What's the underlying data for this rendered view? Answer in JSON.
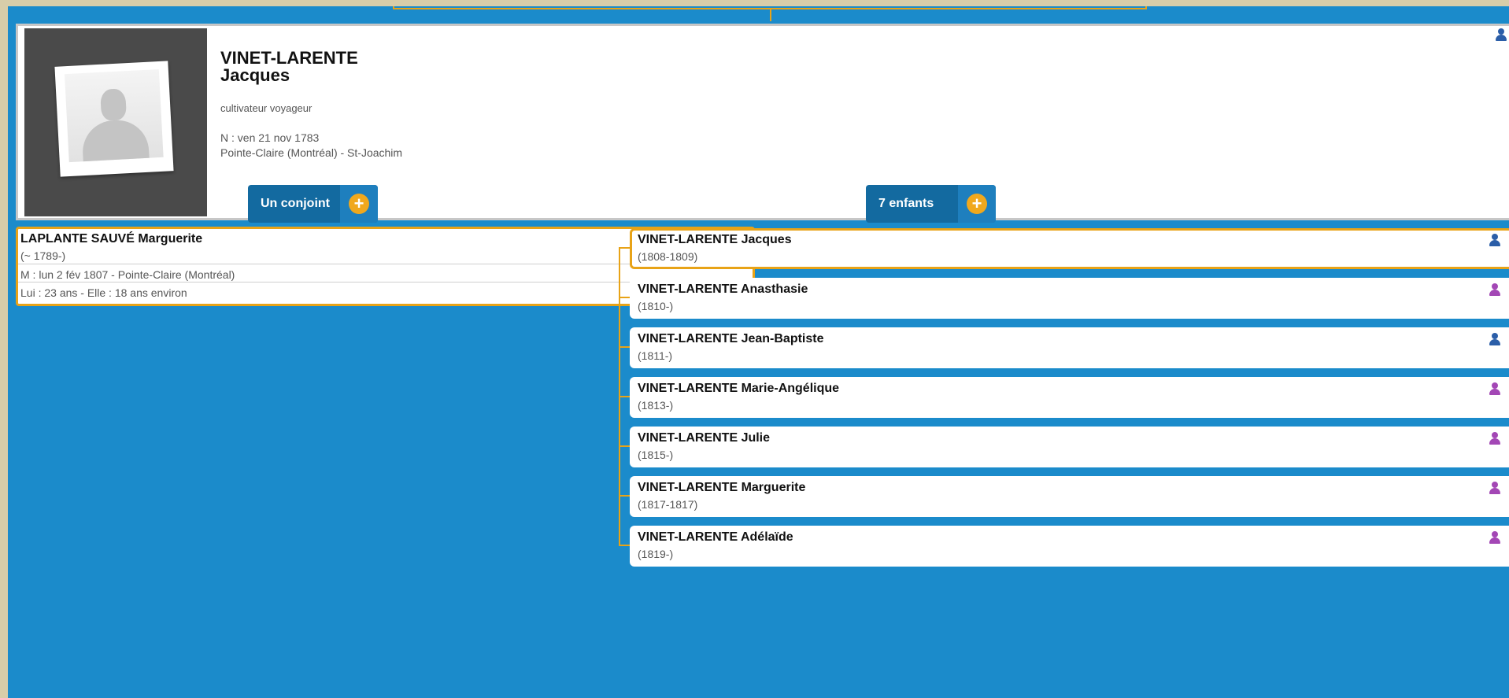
{
  "main_person": {
    "surname": "VINET-LARENTE",
    "given_name": "Jacques",
    "occupation": "cultivateur voyageur",
    "birth": "N : ven 21 nov 1783",
    "birth_place": "Pointe-Claire (Montréal) - St-Joachim",
    "gender": "male"
  },
  "spouse_section": {
    "label": "Un conjoint",
    "add_label": "+"
  },
  "children_section": {
    "label": "7 enfants",
    "add_label": "+"
  },
  "spouse": {
    "name": "LAPLANTE SAUVÉ Marguerite",
    "dates": "(~ 1789-)",
    "marriage": "M : lun 2 fév 1807 - Pointe-Claire (Montréal)",
    "ages": "Lui : 23 ans - Elle : 18 ans environ",
    "gender": "female"
  },
  "children": [
    {
      "name": "VINET-LARENTE Jacques",
      "dates": "(1808-1809)",
      "gender": "male",
      "selected": true
    },
    {
      "name": "VINET-LARENTE Anasthasie",
      "dates": "(1810-)",
      "gender": "female",
      "selected": false
    },
    {
      "name": "VINET-LARENTE Jean-Baptiste",
      "dates": "(1811-)",
      "gender": "male",
      "selected": false
    },
    {
      "name": "VINET-LARENTE Marie-Angélique",
      "dates": "(1813-)",
      "gender": "female",
      "selected": false
    },
    {
      "name": "VINET-LARENTE Julie",
      "dates": "(1815-)",
      "gender": "female",
      "selected": false
    },
    {
      "name": "VINET-LARENTE Marguerite",
      "dates": "(1817-1817)",
      "gender": "female",
      "selected": false
    },
    {
      "name": "VINET-LARENTE Adélaïde",
      "dates": "(1819-)",
      "gender": "female",
      "selected": false
    }
  ],
  "colors": {
    "background": "#1b8bcb",
    "border_accent": "#e8a317",
    "male_icon": "#2b5ea8",
    "female_icon": "#a347b5",
    "add_button": "#f0a81d"
  }
}
